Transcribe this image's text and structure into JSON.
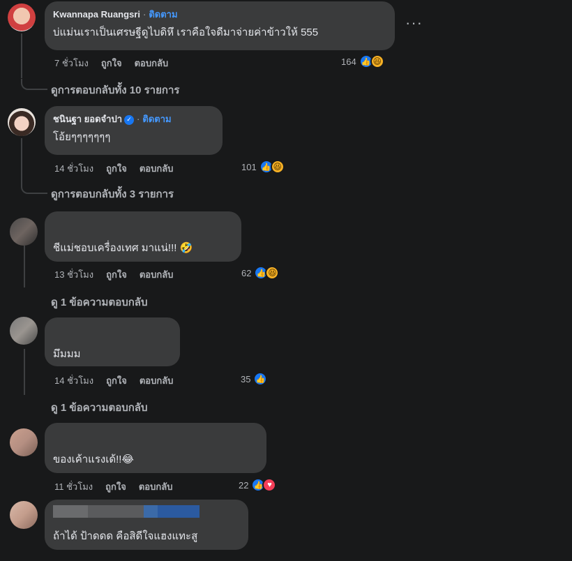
{
  "comments": [
    {
      "author": "Kwannapa Ruangsri",
      "follow": "ติดตาม",
      "text": "บ่แม่นเราเป็นเศรษฐีดูไบดิหึ เราคือใจดีมาจ่ายค่าข้าวให้ 555",
      "time": "7 ชั่วโมง",
      "like": "ถูกใจ",
      "reply": "ตอบกลับ",
      "reaction_count": "164",
      "reactions": [
        "like-icon",
        "haha-icon"
      ],
      "view_replies": "ดูการตอบกลับทั้ง 10 รายการ"
    },
    {
      "author": "ชนินฐา ยอดจำปา",
      "follow": "ติดตาม",
      "text": "โอ้ยๆๆๆๆๆๆๆ",
      "time": "14 ชั่วโมง",
      "like": "ถูกใจ",
      "reply": "ตอบกลับ",
      "reaction_count": "101",
      "reactions": [
        "like-icon",
        "haha-icon"
      ],
      "view_replies": "ดูการตอบกลับทั้ง 3 รายการ"
    },
    {
      "author": "",
      "text": "ชีแม่ชอบเครื่องเทศ มาแน่!!! 🤣",
      "time": "13 ชั่วโมง",
      "like": "ถูกใจ",
      "reply": "ตอบกลับ",
      "reaction_count": "62",
      "reactions": [
        "like-icon",
        "haha-icon"
      ],
      "view_replies": "ดู 1 ข้อความตอบกลับ"
    },
    {
      "author": "",
      "text": "มึมมม",
      "time": "14 ชั่วโมง",
      "like": "ถูกใจ",
      "reply": "ตอบกลับ",
      "reaction_count": "35",
      "reactions": [
        "like-icon"
      ],
      "view_replies": "ดู 1 ข้อความตอบกลับ"
    },
    {
      "author": "",
      "text": "ของเค้าแรงเด้!!😂",
      "time": "11 ชั่วโมง",
      "like": "ถูกใจ",
      "reply": "ตอบกลับ",
      "reaction_count": "22",
      "reactions": [
        "like-icon",
        "love-icon"
      ]
    },
    {
      "author": "",
      "text": "ถ้าได้ ป้าดดด คือสิดีใจแฮงแทะสู"
    }
  ],
  "more_menu": "···",
  "colors": {
    "background": "#18191a",
    "bubble": "#3a3b3c",
    "follow": "#4599ff",
    "like": "#1877f2",
    "haha": "#f7b125",
    "love": "#f33e58"
  }
}
